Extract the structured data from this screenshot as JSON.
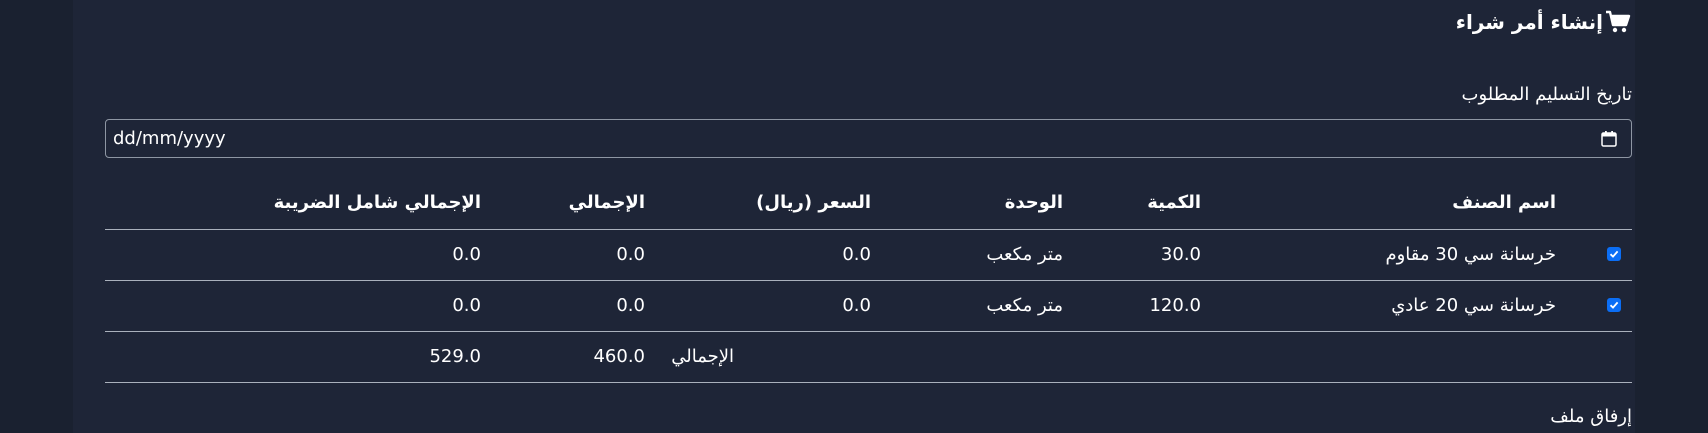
{
  "form": {
    "title": "إنشاء أمر شراء",
    "cart_icon": "cart-icon",
    "date_label": "تاريخ التسليم المطلوب",
    "date_placeholder": "dd/mm/yyyy",
    "calendar_icon": "calendar-icon",
    "attach_label": "إرفاق ملف"
  },
  "table": {
    "headers": {
      "item_name": "اسم الصنف",
      "quantity": "الكمية",
      "unit": "الوحدة",
      "price": "السعر (ريال)",
      "total": "الإجمالي",
      "total_with_tax": "الإجمالي شامل الضريبة"
    },
    "rows": [
      {
        "checked": true,
        "item_name": "خرسانة سي 30 مقاوم",
        "quantity": "30.0",
        "unit": "متر مكعب",
        "price": "0.0",
        "total": "0.0",
        "total_with_tax": "0.0"
      },
      {
        "checked": true,
        "item_name": "خرسانة سي 20 عادي",
        "quantity": "120.0",
        "unit": "متر مكعب",
        "price": "0.0",
        "total": "0.0",
        "total_with_tax": "0.0"
      }
    ],
    "summary": {
      "label": "الإجمالي",
      "total": "460.0",
      "total_with_tax": "529.0"
    }
  },
  "colors": {
    "background": "#1a2130",
    "panel": "#1e2537",
    "checkbox": "#0b6ef5",
    "divider": "#aab1bc"
  }
}
